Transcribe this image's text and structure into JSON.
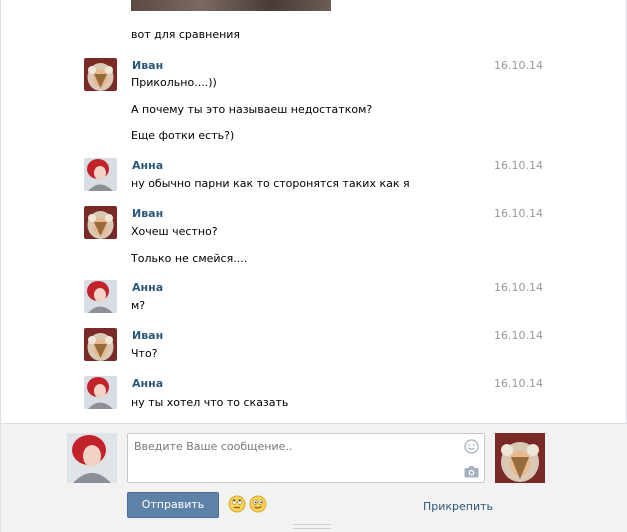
{
  "messages": [
    {
      "author": "",
      "date": "",
      "lines": [
        "вот для сравнения"
      ]
    },
    {
      "author": "Иван",
      "date": "16.10.14",
      "lines": [
        "Прикольно....))",
        "А почему ты это называеш недостатком?",
        "Еще фотки есть?)"
      ]
    },
    {
      "author": "Анна",
      "date": "16.10.14",
      "lines": [
        "ну обычно парни как то сторонятся таких как я"
      ]
    },
    {
      "author": "Иван",
      "date": "16.10.14",
      "lines": [
        "Хочеш честно?",
        "Только не смейся...."
      ]
    },
    {
      "author": "Анна",
      "date": "16.10.14",
      "lines": [
        "м?"
      ]
    },
    {
      "author": "Иван",
      "date": "16.10.14",
      "lines": [
        "Что?"
      ]
    },
    {
      "author": "Анна",
      "date": "16.10.14",
      "lines": [
        "ну ты хотел что то сказать"
      ]
    }
  ],
  "composer": {
    "placeholder": "Введите Ваше сообщение..",
    "send_label": "Отправить",
    "attach_label": "Прикрепить"
  },
  "icons": {
    "smile": "smile-icon",
    "camera": "camera-icon"
  },
  "colors": {
    "name": "#2b587a",
    "date": "#999999",
    "button": "#5e81a8",
    "composer_bg": "#f2f2f2"
  }
}
